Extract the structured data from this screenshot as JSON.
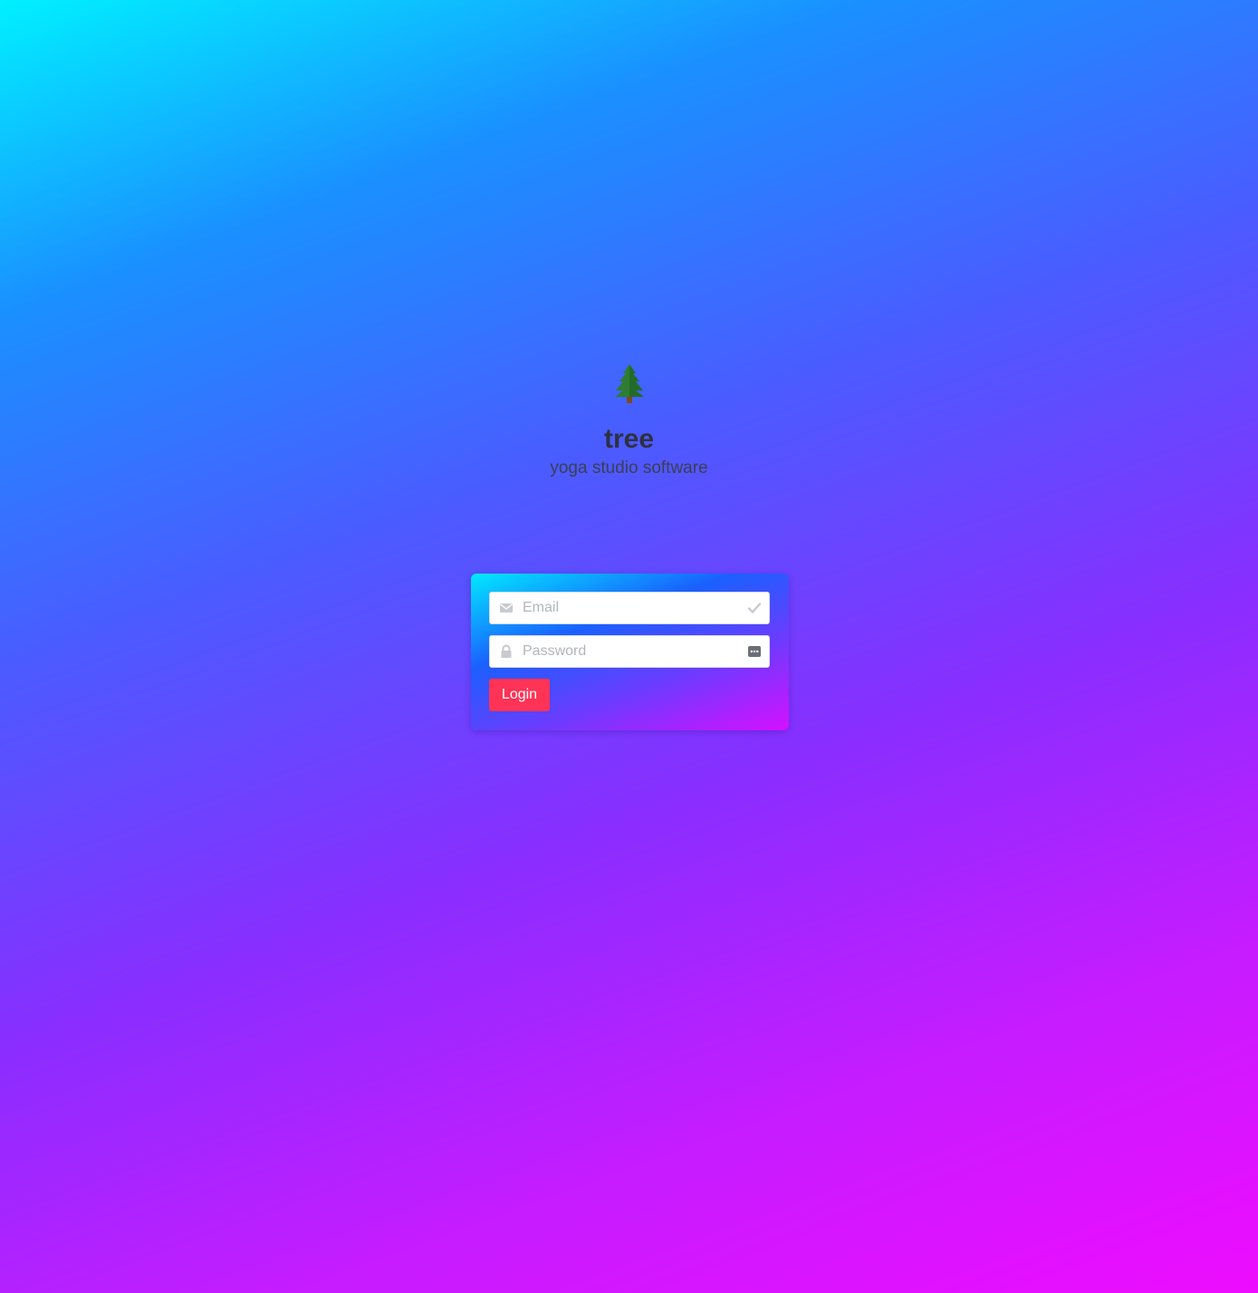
{
  "brand": {
    "icon": "tree-icon",
    "title": "tree",
    "subtitle": "yoga studio software"
  },
  "login_form": {
    "email": {
      "value": "",
      "placeholder": "Email",
      "lead_icon": "envelope-icon",
      "trail_icon": "check-icon"
    },
    "password": {
      "value": "",
      "placeholder": "Password",
      "lead_icon": "lock-icon",
      "trail_icon": "password-manager-icon"
    },
    "submit_label": "Login"
  },
  "colors": {
    "login_button": "#ff3355",
    "title_text": "#2e3140"
  }
}
